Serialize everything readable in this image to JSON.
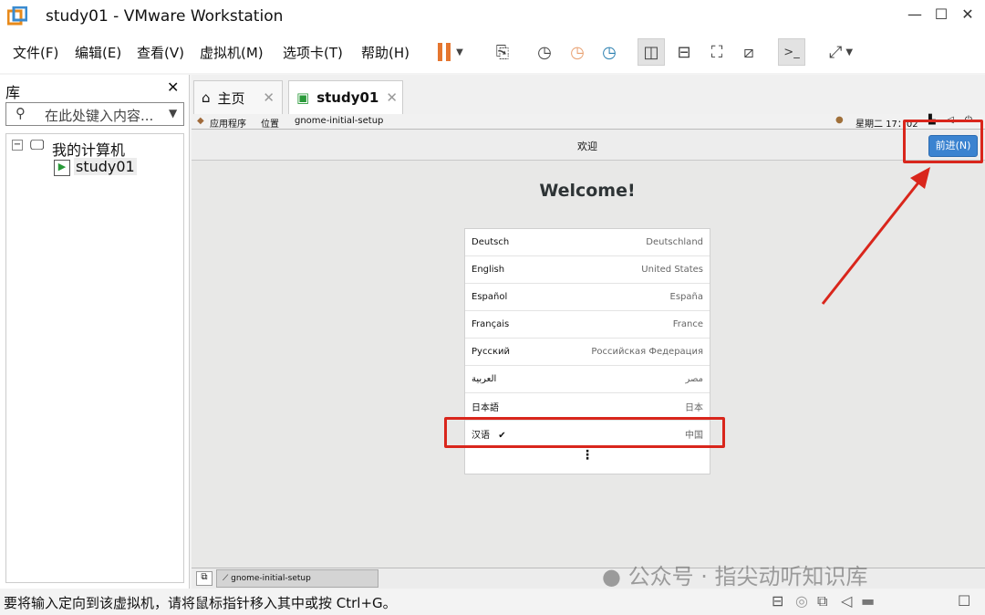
{
  "window": {
    "title": "study01 - VMware Workstation",
    "minimize": "—",
    "maximize": "☐",
    "close": "✕"
  },
  "menu": [
    "文件(F)",
    "编辑(E)",
    "查看(V)",
    "虚拟机(M)",
    "选项卡(T)",
    "帮助(H)"
  ],
  "library": {
    "title": "库",
    "close": "✕",
    "search_placeholder": "在此处键入内容...",
    "tree": {
      "root": "我的计算机",
      "child": "study01"
    }
  },
  "tabs": [
    {
      "label": "主页",
      "close": "✕"
    },
    {
      "label": "study01",
      "close": "✕"
    }
  ],
  "guest": {
    "topbar": {
      "apps": "应用程序",
      "places": "位置",
      "app": "gnome-initial-setup",
      "clock": "星期二 17：02"
    },
    "header": {
      "title": "欢迎",
      "next": "前进(N)"
    },
    "welcome": "Welcome!",
    "languages": [
      {
        "lang": "Deutsch",
        "region": "Deutschland"
      },
      {
        "lang": "English",
        "region": "United States"
      },
      {
        "lang": "Español",
        "region": "España"
      },
      {
        "lang": "Français",
        "region": "France"
      },
      {
        "lang": "Русский",
        "region": "Российская Федерация"
      },
      {
        "lang": "العربية",
        "region": "مصر"
      },
      {
        "lang": "日本語",
        "region": "日本"
      },
      {
        "lang": "汉语",
        "region": "中国",
        "selected": true,
        "check": "✔"
      }
    ],
    "more": "⋮",
    "taskbar_item": "gnome-initial-setup"
  },
  "status": "要将输入定向到该虚拟机，请将鼠标指针移入其中或按 Ctrl+G。",
  "watermark": "公众号 · 指尖动听知识库",
  "colors": {
    "accent": "#3b83d0",
    "highlight": "#d9261c",
    "pause": "#e5762f"
  }
}
